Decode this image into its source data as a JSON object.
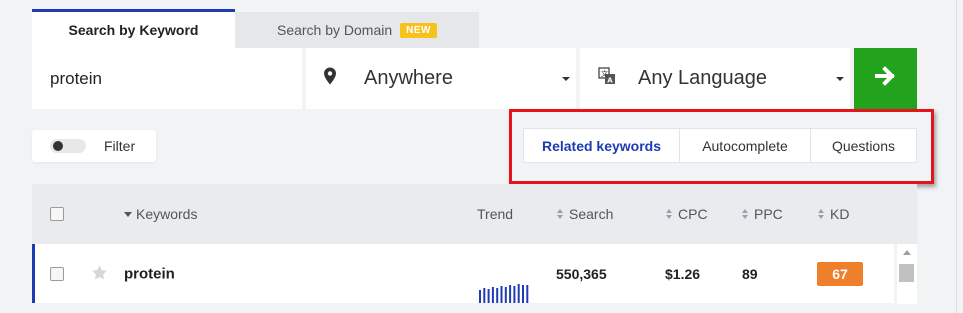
{
  "tabs": {
    "keyword_label": "Search by Keyword",
    "domain_label": "Search by Domain",
    "domain_badge": "NEW"
  },
  "search": {
    "keyword_value": "protein",
    "location_value": "Anywhere",
    "language_value": "Any Language",
    "submit_icon": "arrow-right-icon"
  },
  "filter": {
    "label": "Filter",
    "enabled": false
  },
  "modes": {
    "items": [
      "Related keywords",
      "Autocomplete",
      "Questions"
    ],
    "active": "Related keywords"
  },
  "table": {
    "headers": {
      "keywords": "Keywords",
      "trend": "Trend",
      "search": "Search",
      "cpc": "CPC",
      "ppc": "PPC",
      "kd": "KD"
    },
    "rows": [
      {
        "keyword": "protein",
        "search": "550,365",
        "cpc": "$1.26",
        "ppc": "89",
        "kd": "67",
        "trend": [
          0.65,
          0.75,
          0.7,
          0.8,
          0.75,
          0.85,
          0.8,
          0.9,
          0.85,
          0.95,
          0.9,
          0.9
        ]
      }
    ]
  },
  "colors": {
    "accent_blue": "#1e3bb3",
    "go_green": "#23a31d",
    "kd_orange": "#f07f2c",
    "badge_yellow": "#f7c21c",
    "highlight_red": "#e3141b"
  }
}
